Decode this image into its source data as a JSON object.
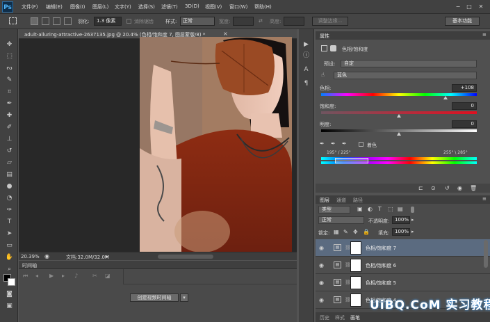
{
  "app": {
    "logo": "Ps"
  },
  "menu": [
    "文件(F)",
    "编辑(E)",
    "图像(I)",
    "图层(L)",
    "文字(Y)",
    "选择(S)",
    "滤镜(T)",
    "3D(D)",
    "视图(V)",
    "窗口(W)",
    "帮助(H)"
  ],
  "window_controls": {
    "minimize": "−",
    "maximize": "□",
    "close": "✕"
  },
  "options": {
    "feather_label": "羽化:",
    "feather_value": "1.3 像素",
    "antialias_label": "消除锯齿",
    "style_label": "样式:",
    "style_value": "正常",
    "width_label": "宽度:",
    "height_label": "高度:",
    "refine_edge": "调整边缘...",
    "workspace": "基本功能"
  },
  "document": {
    "tab_title": "adult-alluring-attractive-2637135.jpg @ 20.4% (色相/饱和度 7, 图层蒙版/8) *",
    "close": "×"
  },
  "status": {
    "zoom": "20.39%",
    "doc_size": "文档:32.0M/32.0M"
  },
  "timeline": {
    "header": "时间轴",
    "create_button": "创建视频时间轴"
  },
  "properties": {
    "tab": "属性",
    "panel_title": "色相/饱和度",
    "preset_label": "预设:",
    "preset_value": "自定",
    "channel_value": "蓝色",
    "hue_label": "色相:",
    "hue_value": "+108",
    "hue_pos": 0.8,
    "saturation_label": "饱和度:",
    "saturation_value": "0",
    "saturation_pos": 0.5,
    "lightness_label": "明度:",
    "lightness_value": "0",
    "lightness_pos": 0.5,
    "colorize_label": "着色",
    "range_left": "195° / 225°",
    "range_right": "255° \\ 285°"
  },
  "layers_panel": {
    "tabs": [
      "图层",
      "通道",
      "路径"
    ],
    "filter_value": "类型",
    "blend_mode": "正常",
    "opacity_label": "不透明度:",
    "opacity_value": "100%",
    "lock_label": "锁定:",
    "fill_label": "填充:",
    "fill_value": "100%",
    "layers": [
      {
        "name": "色相/饱和度 7",
        "selected": true
      },
      {
        "name": "色相/饱和度 6",
        "selected": false
      },
      {
        "name": "色相/饱和度 5",
        "selected": false
      },
      {
        "name": "色相/饱和度 4",
        "selected": false
      }
    ],
    "bottom_tabs": [
      "历史",
      "样式",
      "画笔"
    ]
  },
  "watermark": "UiBQ.CoM 实习教程"
}
